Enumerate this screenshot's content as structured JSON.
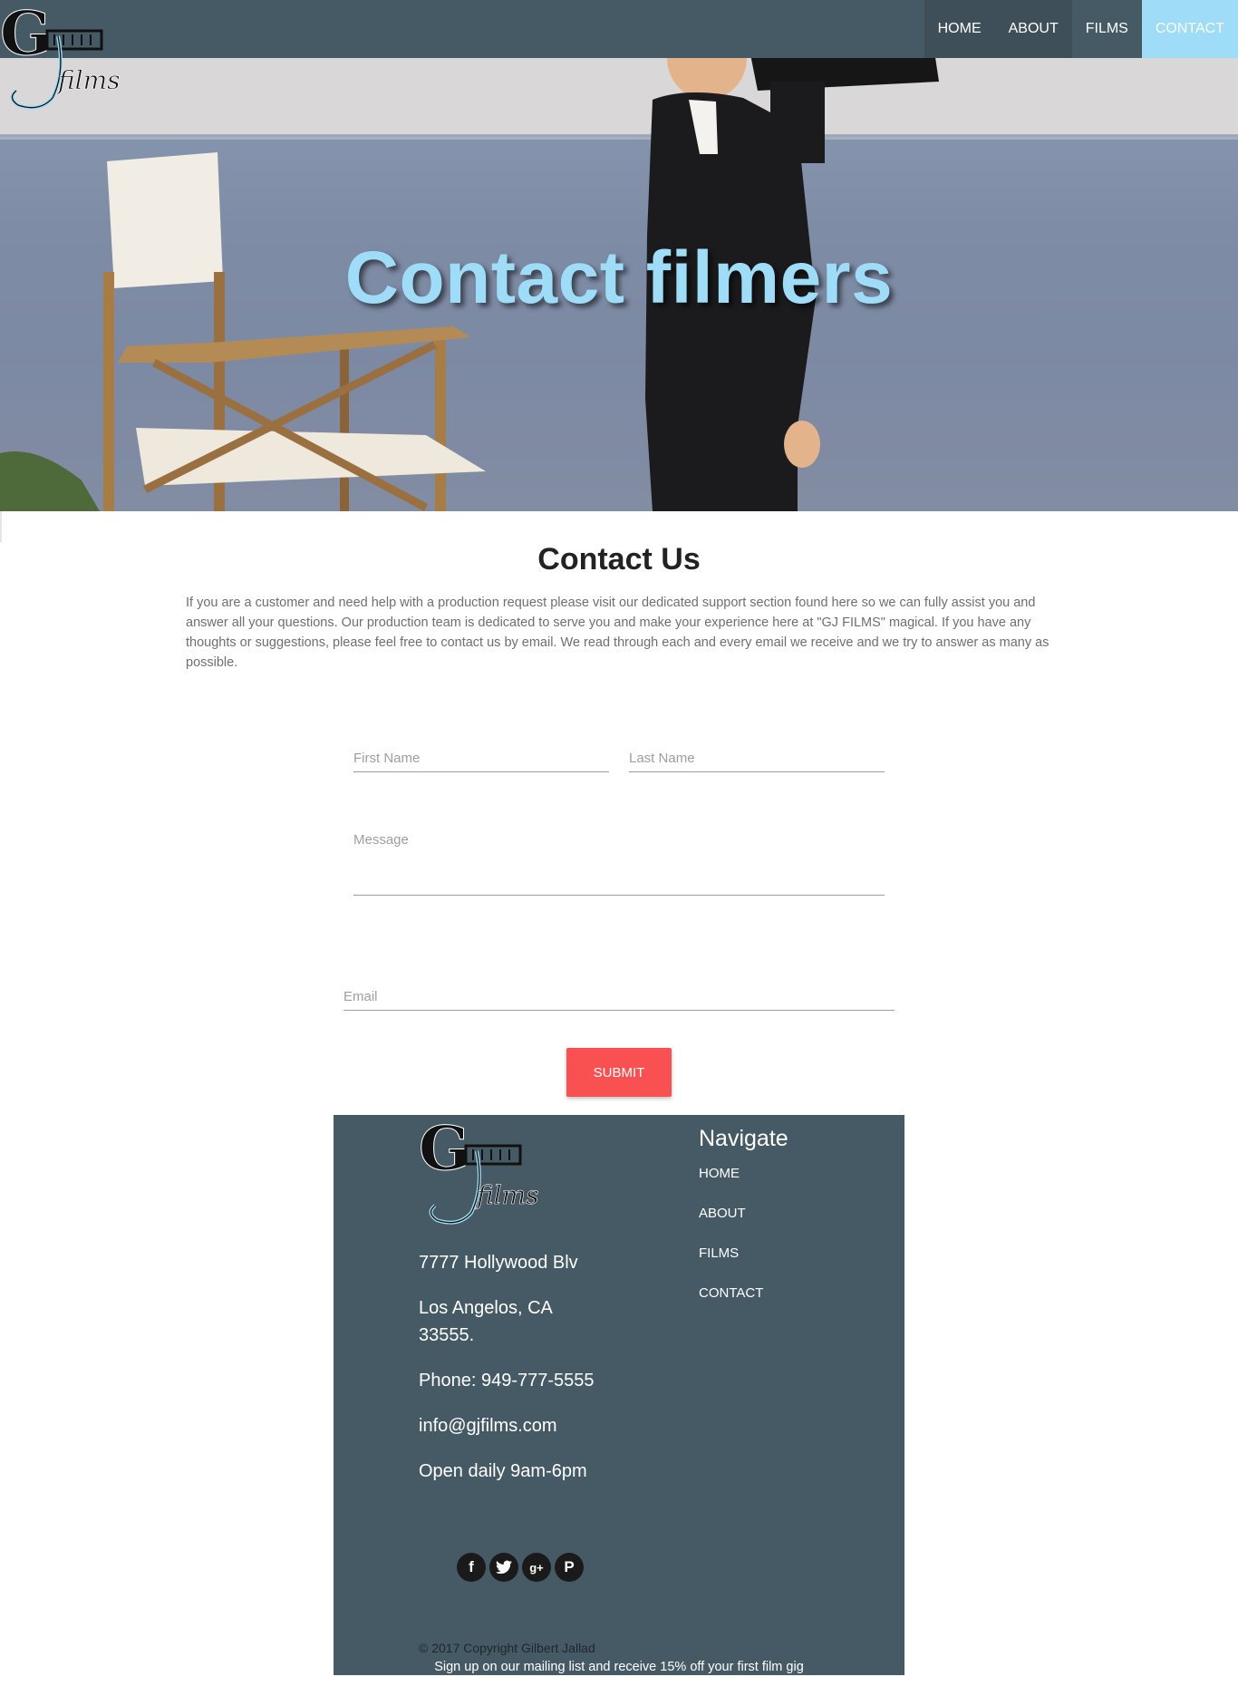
{
  "colors": {
    "nav_bg": "#465a66",
    "accent": "#9edcf7",
    "submit": "#f95052"
  },
  "brand": {
    "logo_text": "GJ films"
  },
  "nav": {
    "items": [
      {
        "label": "HOME"
      },
      {
        "label": "ABOUT"
      },
      {
        "label": "FILMS"
      },
      {
        "label": "CONTACT",
        "active": true
      }
    ]
  },
  "hero": {
    "title": "Contact filmers"
  },
  "contact": {
    "heading": "Contact Us",
    "text": "If you are a customer and need help with a production request please visit our dedicated support section found here so we can fully assist you and answer all your questions. Our production team is dedicated to serve you and make your experience here at \"GJ FILMS\" magical. If you have any thoughts or suggestions, please feel free to contact us by email. We read through each and every email we receive and we try to answer as many as possible."
  },
  "form": {
    "first_name_placeholder": "First Name",
    "first_name_value": "",
    "last_name_placeholder": "Last Name",
    "last_name_value": "",
    "message_placeholder": "Message",
    "message_value": "",
    "email_placeholder": "Email",
    "email_value": "",
    "submit_label": "SUBMIT"
  },
  "footer": {
    "address_line1": "7777 Hollywood Blv",
    "address_line2": "Los Angelos, CA",
    "address_line3": "33555.",
    "phone": "Phone: 949-777-5555",
    "email": "info@gjfilms.com",
    "hours": "Open daily 9am-6pm",
    "navigate_heading": "Navigate",
    "links": [
      {
        "label": "HOME"
      },
      {
        "label": "ABOUT"
      },
      {
        "label": "FILMS"
      },
      {
        "label": "CONTACT"
      }
    ],
    "social": [
      {
        "icon": "facebook-icon",
        "glyph": "f"
      },
      {
        "icon": "twitter-icon",
        "glyph": "t"
      },
      {
        "icon": "google-plus-icon",
        "glyph": "g+"
      },
      {
        "icon": "pinterest-icon",
        "glyph": "P"
      }
    ],
    "copyright": "© 2017 Copyright Gilbert Jallad",
    "mailing": "Sign up on our mailing list and receive 15% off your first film gig"
  }
}
